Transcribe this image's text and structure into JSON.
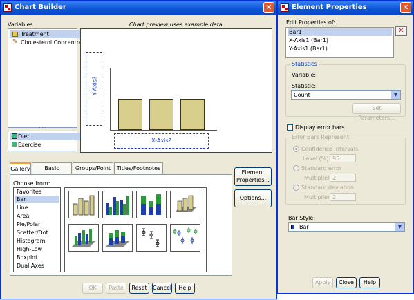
{
  "chart_builder": {
    "title": "Chart Builder",
    "variables_label": "Variables:",
    "variables": [
      "Treatment",
      "Cholesterol Concentrat..."
    ],
    "categories": [
      "Diet",
      "Exercise"
    ],
    "preview_caption": "Chart preview uses example data",
    "y_axis_drop": "Y-Axis?",
    "x_axis_drop": "X-Axis?",
    "element_properties_button": "Element Properties...",
    "options_button": "Options...",
    "tabs": [
      "Gallery",
      "Basic Elements",
      "Groups/Point ID",
      "Titles/Footnotes"
    ],
    "choose_from_label": "Choose from:",
    "chart_types": [
      "Favorites",
      "Bar",
      "Line",
      "Area",
      "Pie/Polar",
      "Scatter/Dot",
      "Histogram",
      "High-Low",
      "Boxplot",
      "Dual Axes"
    ],
    "selected_chart_type": "Bar",
    "bottom_buttons": {
      "ok": "OK",
      "paste": "Paste",
      "reset": "Reset",
      "cancel": "Cancel",
      "help": "Help"
    }
  },
  "element_properties": {
    "title": "Element Properties",
    "edit_properties_label": "Edit Properties of:",
    "elements": [
      "Bar1",
      "X-Axis1 (Bar1)",
      "Y-Axis1 (Bar1)"
    ],
    "statistics_group": "Statistics",
    "variable_label": "Variable:",
    "statistic_label": "Statistic:",
    "statistic_value": "Count",
    "set_parameters_button": "Set Parameters...",
    "display_error_bars": "Display error bars",
    "error_bars_group": "Error Bars Represent",
    "confidence_intervals": "Confidence intervals",
    "level_label": "Level (%):",
    "level_value": "95",
    "standard_error": "Standard error",
    "standard_deviation": "Standard deviation",
    "multiplier_label": "Multiplier:",
    "multiplier_value": "2",
    "bar_style_label": "Bar Style:",
    "bar_style_value": "Bar",
    "apply_button": "Apply",
    "close_button": "Close",
    "help_button": "Help"
  },
  "colors": {
    "titlebar": "#0a55d8",
    "selection": "#c1d2ee",
    "accent_tab": "#f5a02c",
    "drop_zone": "#1a3dcc",
    "bar_fill": "#d8cf8c"
  }
}
